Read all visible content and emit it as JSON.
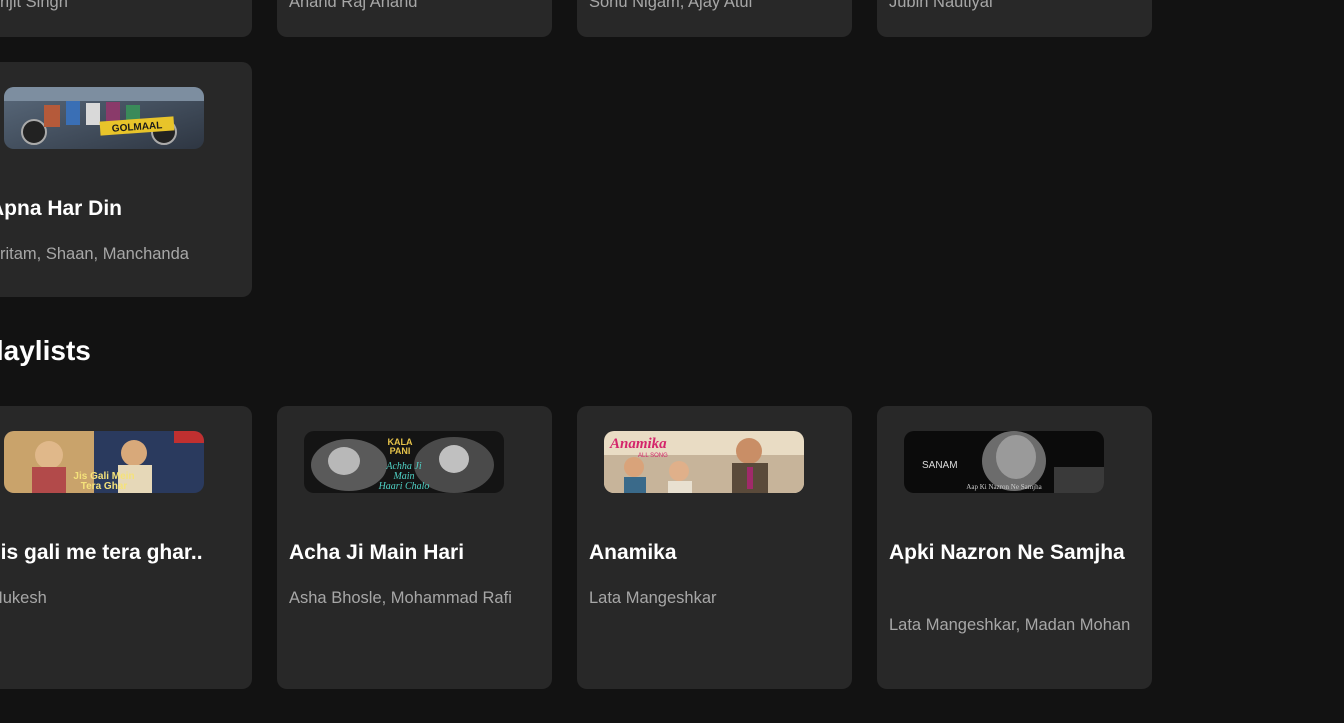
{
  "top_row": {
    "cards": [
      {
        "subtitle": "Arijit Singh"
      },
      {
        "subtitle": "Anand Raj Anand"
      },
      {
        "subtitle": "Sonu Nigam, Ajay Atul"
      },
      {
        "subtitle": "Jubin Nautiyal"
      }
    ]
  },
  "previous_section": {
    "card": {
      "title": "Apna Har Din",
      "subtitle": "Pritam, Shaan, Manchanda",
      "thumb": {
        "caption": "GOLMAAL",
        "colors": [
          "#4a5a6e",
          "#6b7b8a",
          "#e8c42a"
        ]
      }
    }
  },
  "section": {
    "title": "Old Song Playlists",
    "cards": [
      {
        "title": "Jis gali me tera ghar..",
        "subtitle": "Mukesh",
        "thumb": {
          "caption": "Jis Gali Mein Tera Ghar",
          "colors": [
            "#c9a36b",
            "#2a3a5e",
            "#d7c08c"
          ]
        }
      },
      {
        "title": "Acha Ji Main Hari",
        "subtitle": "Asha Bhosle, Mohammad Rafi",
        "thumb": {
          "caption": "KALA PANI · Achha Ji Main Haari Chalo",
          "colors": [
            "#1a1a1a",
            "#6a6a6a",
            "#e6c34a"
          ]
        }
      },
      {
        "title": "Anamika",
        "subtitle": "Lata Mangeshkar",
        "thumb": {
          "caption": "Anamika ALL SONG",
          "colors": [
            "#f2e6cf",
            "#c47a4b",
            "#d4246b"
          ]
        }
      },
      {
        "title": "Apki Nazron Ne Samjha",
        "subtitle": "Lata Mangeshkar, Madan Mohan",
        "thumb": {
          "caption": "SANAM · Aap Ki Nazron Ne Samjha",
          "colors": [
            "#0b0b0b",
            "#8a8a8a",
            "#d8d8d8"
          ]
        }
      }
    ]
  },
  "theme": {
    "background": "#121212",
    "card": "#282828",
    "subtext": "#a7a7a7"
  }
}
